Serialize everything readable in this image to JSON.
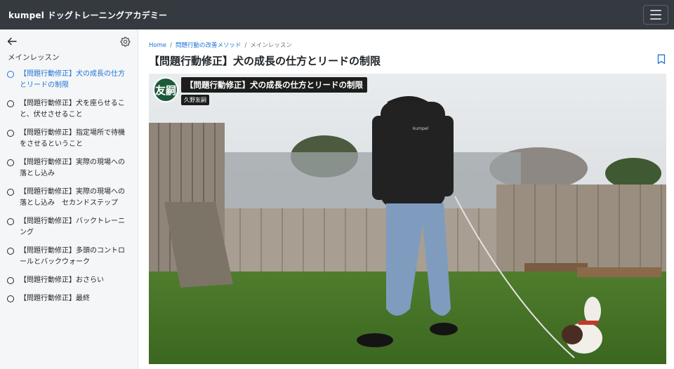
{
  "header": {
    "brand": "kumpel ドッグトレーニングアカデミー",
    "menu_icon": "hamburger-icon"
  },
  "sidebar": {
    "back_icon": "arrow-left-icon",
    "settings_icon": "gear-icon",
    "title": "メインレッスン",
    "lessons": [
      {
        "label": "【問題行動修正】犬の成長の仕方とリードの制限",
        "active": true
      },
      {
        "label": "【問題行動修正】犬を座らせること、伏せさせること",
        "active": false
      },
      {
        "label": "【問題行動修正】指定場所で待機をさせるということ",
        "active": false
      },
      {
        "label": "【問題行動修正】実際の現場への落とし込み",
        "active": false
      },
      {
        "label": "【問題行動修正】実際の現場への落とし込み　セカンドステップ",
        "active": false
      },
      {
        "label": "【問題行動修正】バックトレーニング",
        "active": false
      },
      {
        "label": "【問題行動修正】多頭のコントロールとバックウォーク",
        "active": false
      },
      {
        "label": "【問題行動修正】おさらい",
        "active": false
      },
      {
        "label": "【問題行動修正】最終",
        "active": false
      }
    ]
  },
  "breadcrumb": {
    "home": "Home",
    "category": "問題行動の改善メソッド",
    "current": "メインレッスン",
    "separator": "/"
  },
  "main": {
    "title": "【問題行動修正】犬の成長の仕方とリードの制限",
    "bookmark_icon": "bookmark-icon"
  },
  "video": {
    "avatar_text": "友嗣",
    "title": "【問題行動修正】犬の成長の仕方とリードの制限",
    "channel": "久野友嗣",
    "hoodie_logo": "kumpel"
  },
  "colors": {
    "topbar": "#343a40",
    "accent": "#1f74d6",
    "sidebar_bg": "#f5f6f7"
  }
}
